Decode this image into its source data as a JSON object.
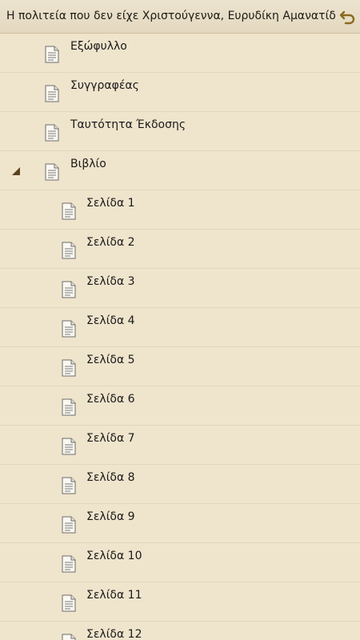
{
  "header": {
    "title": "Η πολιτεία που δεν είχε Χριστούγεννα, Ευρυδίκη Αμανατίδου",
    "back_icon": "back-arrow-icon",
    "accent": "#8a6a20"
  },
  "toc": {
    "top_items": [
      {
        "label": "Εξώφυλλο"
      },
      {
        "label": "Συγγραφέας"
      },
      {
        "label": "Ταυτότητα Έκδοσης"
      }
    ],
    "book": {
      "label": "Βιβλίο",
      "expanded": true,
      "pages": [
        {
          "label": "Σελίδα 1"
        },
        {
          "label": "Σελίδα 2"
        },
        {
          "label": "Σελίδα 3"
        },
        {
          "label": "Σελίδα 4"
        },
        {
          "label": "Σελίδα 5"
        },
        {
          "label": "Σελίδα 6"
        },
        {
          "label": "Σελίδα 7"
        },
        {
          "label": "Σελίδα 8"
        },
        {
          "label": "Σελίδα 9"
        },
        {
          "label": "Σελίδα 10"
        },
        {
          "label": "Σελίδα 11"
        },
        {
          "label": "Σελίδα 12"
        }
      ]
    }
  }
}
